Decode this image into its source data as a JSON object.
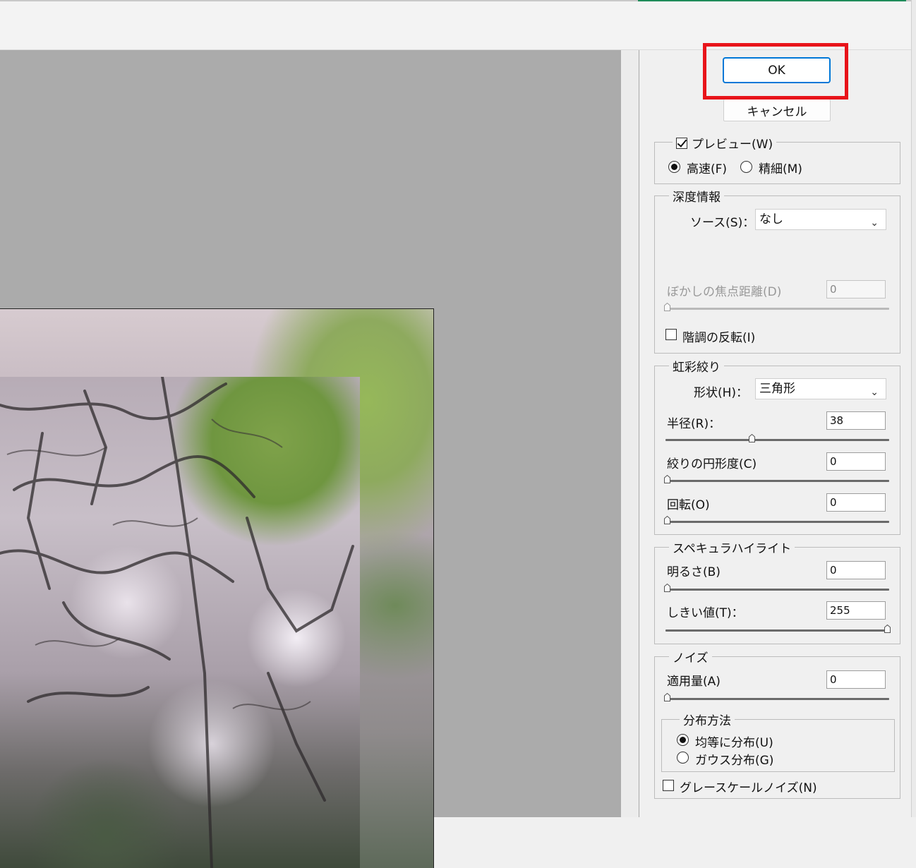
{
  "buttons": {
    "ok_label": "OK",
    "cancel_label": "キャンセル"
  },
  "preview": {
    "checkbox_label": "プレビュー(W)",
    "checked": true,
    "fast_label": "高速(F)",
    "fine_label": "精細(M)",
    "selected": "fast"
  },
  "depth": {
    "legend": "深度情報",
    "source_label": "ソース(S)：",
    "source_value": "なし",
    "focal_label": "ぼかしの焦点距離(D)",
    "focal_value": "0",
    "focal_level": 0,
    "invert_label": "階調の反転(I)",
    "invert_checked": false
  },
  "iris": {
    "legend": "虹彩絞り",
    "shape_label": "形状(H)：",
    "shape_value": "三角形",
    "radius_label": "半径(R)：",
    "radius_value": "38",
    "radius_level": 0.38,
    "curvature_label": "絞りの円形度(C)",
    "curvature_value": "0",
    "rotation_label": "回転(O)",
    "rotation_value": "0"
  },
  "specular": {
    "legend": "スペキュラハイライト",
    "brightness_label": "明るさ(B)",
    "brightness_value": "0",
    "threshold_label": "しきい値(T)：",
    "threshold_value": "255",
    "threshold_level": 1.0
  },
  "noise": {
    "legend": "ノイズ",
    "amount_label": "適用量(A)",
    "amount_value": "0",
    "distribution_legend": "分布方法",
    "uniform_label": "均等に分布(U)",
    "gaussian_label": "ガウス分布(G)",
    "selected": "uniform",
    "monochrome_label": "グレースケールノイズ(N)",
    "monochrome_checked": false
  },
  "colors": {
    "ok_border": "#0078d7",
    "highlight": "#e8141a",
    "preview_bg": "#ababab"
  }
}
